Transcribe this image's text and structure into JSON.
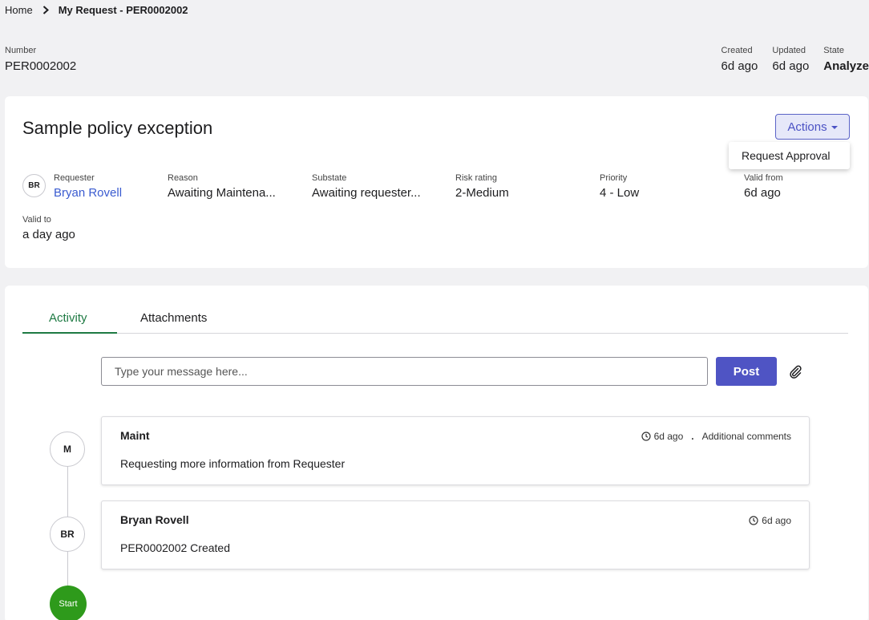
{
  "breadcrumb": {
    "home": "Home",
    "separator": "❯",
    "current": "My Request - PER0002002"
  },
  "record": {
    "number_label": "Number",
    "number": "PER0002002",
    "created_label": "Created",
    "created": "6d ago",
    "updated_label": "Updated",
    "updated": "6d ago",
    "state_label": "State",
    "state": "Analyze"
  },
  "summary": {
    "title": "Sample policy exception",
    "actions_label": "Actions",
    "dropdown_item": "Request Approval",
    "requester_avatar": "BR",
    "fields": {
      "requester": {
        "label": "Requester",
        "value": "Bryan Rovell"
      },
      "reason": {
        "label": "Reason",
        "value": "Awaiting Maintena..."
      },
      "substate": {
        "label": "Substate",
        "value": "Awaiting requester..."
      },
      "risk": {
        "label": "Risk rating",
        "value": "2-Medium"
      },
      "priority": {
        "label": "Priority",
        "value": "4 - Low"
      },
      "valid_from": {
        "label": "Valid from",
        "value": "6d ago"
      },
      "valid_to": {
        "label": "Valid to",
        "value": "a day ago"
      }
    }
  },
  "activity": {
    "tabs": [
      {
        "label": "Activity",
        "active": true
      },
      {
        "label": "Attachments",
        "active": false
      }
    ],
    "input_placeholder": "Type your message here...",
    "post_label": "Post",
    "entries": [
      {
        "avatar": "M",
        "author": "Maint",
        "time": "6d ago",
        "type": "Additional comments",
        "body": "Requesting more information from Requester"
      },
      {
        "avatar": "BR",
        "author": "Bryan Rovell",
        "time": "6d ago",
        "type": "",
        "body": "PER0002002 Created"
      }
    ],
    "start_label": "Start"
  },
  "colors": {
    "accent": "#4f54c4",
    "tab_active": "#1e7a43",
    "start": "#2e9a1b",
    "link": "#3a5bd0"
  },
  "icons": {
    "separator": "chevron-right-icon",
    "attach": "paperclip-icon",
    "time": "clock-icon"
  }
}
